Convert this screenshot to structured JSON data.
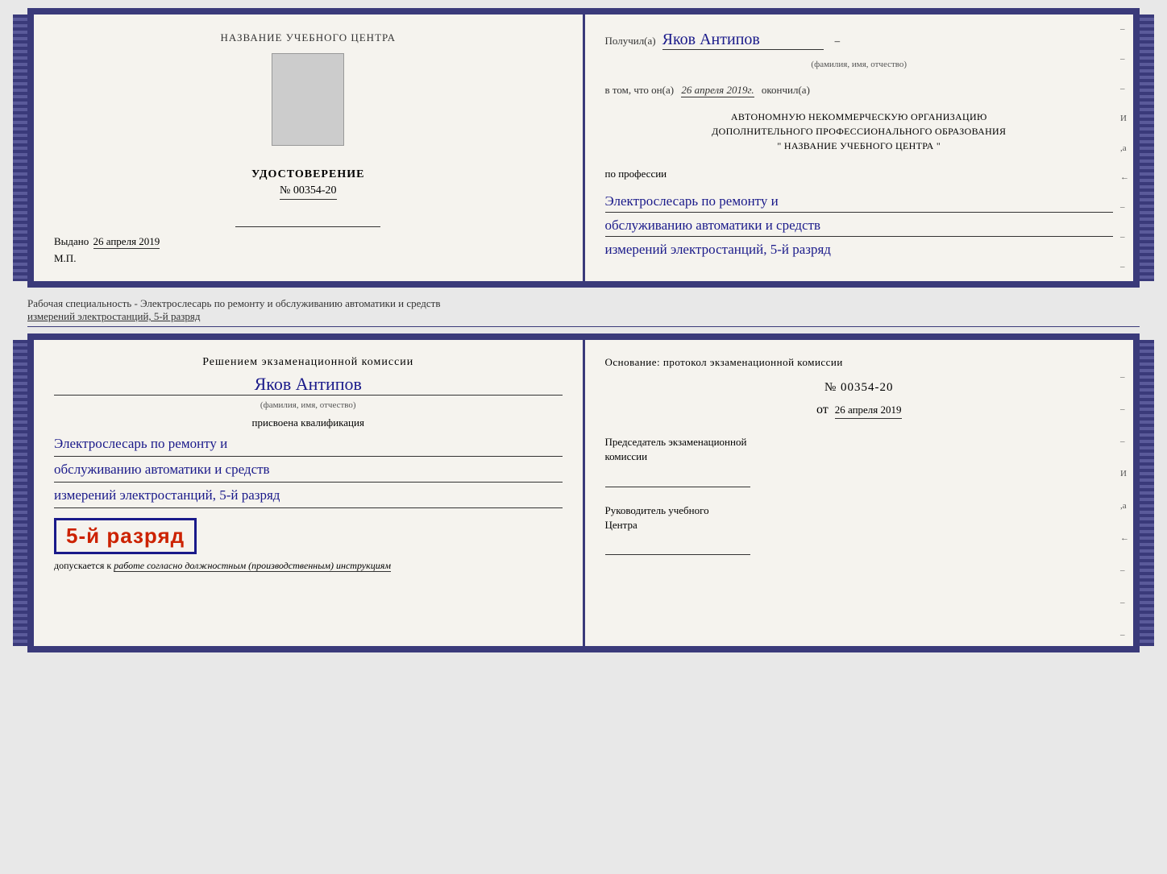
{
  "top_cert": {
    "left": {
      "center_title": "НАЗВАНИЕ УЧЕБНОГО ЦЕНТРА",
      "udostoverenie_label": "УДОСТОВЕРЕНИЕ",
      "number": "№ 00354-20",
      "vydano_label": "Выдано",
      "vydano_date": "26 апреля 2019",
      "mp": "М.П."
    },
    "right": {
      "poluchil_prefix": "Получил(а)",
      "name": "Яков Антипов",
      "fio_label": "(фамилия, имя, отчество)",
      "vtom_prefix": "в том, что он(а)",
      "vtom_date": "26 апреля 2019г.",
      "okončil": "окончил(а)",
      "org_line1": "АВТОНОМНУЮ НЕКОММЕРЧЕСКУЮ ОРГАНИЗАЦИЮ",
      "org_line2": "ДОПОЛНИТЕЛЬНОГО ПРОФЕССИОНАЛЬНОГО ОБРАЗОВАНИЯ",
      "org_line3": "\"   НАЗВАНИЕ УЧЕБНОГО ЦЕНТРА   \"",
      "po_professii": "по профессии",
      "profession_line1": "Электрослесарь по ремонту и",
      "profession_line2": "обслуживанию автоматики и средств",
      "profession_line3": "измерений электростанций, 5-й разряд",
      "right_deco": [
        "–",
        "–",
        "–",
        "И",
        ",а",
        "←",
        "–",
        "–",
        "–"
      ]
    }
  },
  "middle": {
    "text_line1": "Рабочая специальность - Электрослесарь по ремонту и обслуживанию автоматики и средств",
    "text_line2": "измерений электростанций, 5-й разряд"
  },
  "bottom_cert": {
    "left": {
      "resheniem_title": "Решением экзаменационной комиссии",
      "name": "Яков Антипов",
      "fio_label": "(фамилия, имя, отчество)",
      "prisvoena": "присвоена квалификация",
      "qual_line1": "Электрослесарь по ремонту и",
      "qual_line2": "обслуживанию автоматики и средств",
      "qual_line3": "измерений электростанций, 5-й разряд",
      "razryad_badge": "5-й разряд",
      "dopuskaetsya_prefix": "допускается к",
      "dopuskaetsya_italic": "работе согласно должностным (производственным) инструкциям"
    },
    "right": {
      "osnovanie": "Основание: протокол экзаменационной комиссии",
      "protocol_number": "№ 00354-20",
      "ot_prefix": "от",
      "ot_date": "26 апреля 2019",
      "predsedatel_line1": "Председатель экзаменационной",
      "predsedatel_line2": "комиссии",
      "rukovoditel_line1": "Руководитель учебного",
      "rukovoditel_line2": "Центра",
      "right_deco": [
        "–",
        "–",
        "–",
        "И",
        ",а",
        "←",
        "–",
        "–",
        "–"
      ]
    }
  }
}
